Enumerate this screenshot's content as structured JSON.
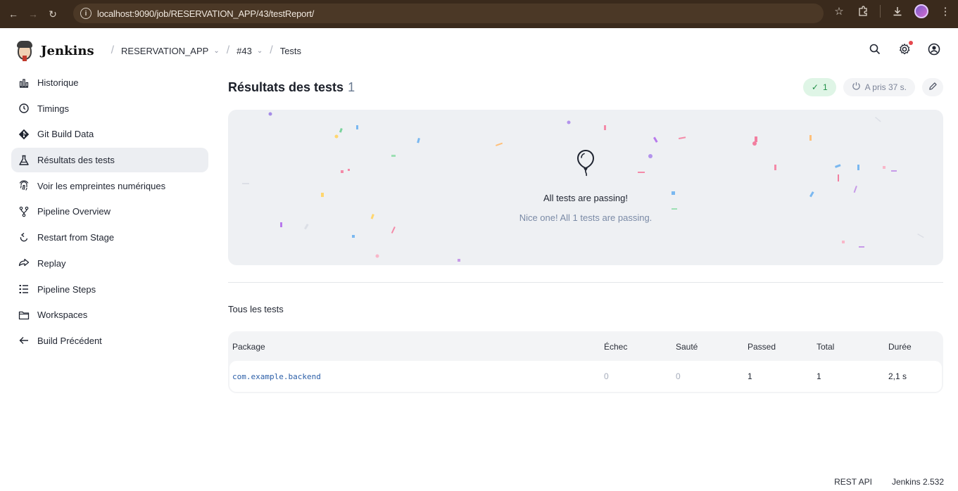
{
  "browser": {
    "url": "localhost:9090/job/RESERVATION_APP/43/testReport/"
  },
  "header": {
    "brand": "Jenkins",
    "breadcrumbs": [
      {
        "label": "RESERVATION_APP"
      },
      {
        "label": "#43"
      },
      {
        "label": "Tests"
      }
    ]
  },
  "sidebar": {
    "items": [
      {
        "label": "Historique",
        "icon": "history-bars-icon"
      },
      {
        "label": "Timings",
        "icon": "timer-icon"
      },
      {
        "label": "Git Build Data",
        "icon": "git-icon"
      },
      {
        "label": "Résultats des tests",
        "icon": "flask-icon",
        "active": true
      },
      {
        "label": "Voir les empreintes numériques",
        "icon": "fingerprint-icon"
      },
      {
        "label": "Pipeline Overview",
        "icon": "pipeline-fork-icon"
      },
      {
        "label": "Restart from Stage",
        "icon": "restart-icon"
      },
      {
        "label": "Replay",
        "icon": "replay-icon"
      },
      {
        "label": "Pipeline Steps",
        "icon": "list-steps-icon"
      },
      {
        "label": "Workspaces",
        "icon": "folder-icon"
      },
      {
        "label": "Build Précédent",
        "icon": "arrow-left-icon"
      }
    ]
  },
  "main": {
    "title": "Résultats des tests",
    "title_count": "1",
    "passed_badge": "1",
    "duration_badge": "A pris 37 s.",
    "hero_message": "All tests are passing!",
    "hero_sub": "Nice one! All 1 tests are passing.",
    "section_title": "Tous les tests",
    "table": {
      "headers": [
        "Package",
        "Échec",
        "Sauté",
        "Passed",
        "Total",
        "Durée"
      ],
      "rows": [
        {
          "package": "com.example.backend",
          "echec": "0",
          "saute": "0",
          "passed": "1",
          "total": "1",
          "duree": "2,1 s"
        }
      ]
    }
  },
  "footer": {
    "rest_api": "REST API",
    "version": "Jenkins 2.532"
  },
  "colors": {
    "browser_chrome": "#3a2a1c",
    "success": "#1f8f46",
    "link": "#2c5fa8",
    "hero_bg": "#eef0f3"
  }
}
